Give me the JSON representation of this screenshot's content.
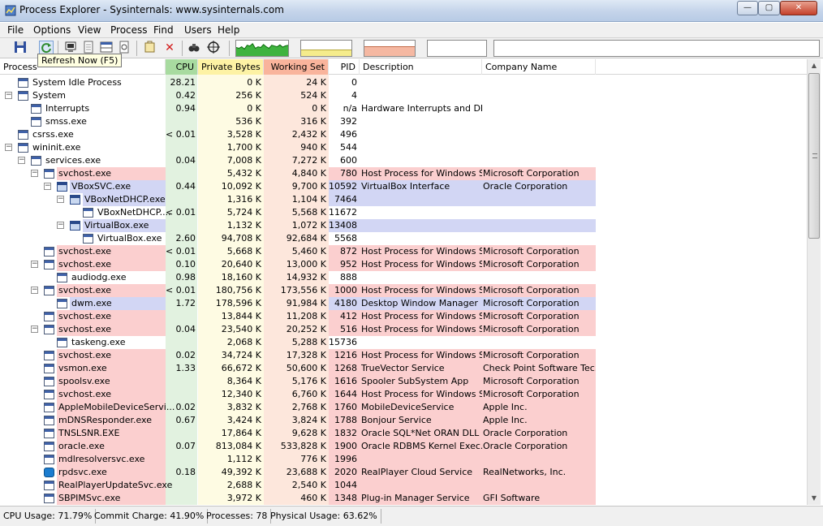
{
  "window": {
    "title": "Process Explorer - Sysinternals: www.sysinternals.com",
    "min_glyph": "—",
    "max_glyph": "▢",
    "close_glyph": "✕"
  },
  "menu": [
    "File",
    "Options",
    "View",
    "Process",
    "Find",
    "Users",
    "Help"
  ],
  "toolbar": {
    "tooltip": "Refresh Now (F5)",
    "icons": [
      "save-icon",
      "refresh-icon",
      "system-info-icon",
      "properties-icon",
      "lower-pane-icon",
      "dll-view-icon",
      "kill-process-icon",
      "find-icon",
      "target-window-icon"
    ]
  },
  "columns": {
    "process": "Process",
    "cpu": "CPU",
    "private_bytes": "Private Bytes",
    "working_set": "Working Set",
    "pid": "PID",
    "description": "Description",
    "company": "Company Name"
  },
  "colors": {
    "cpu_col": "#e2f2e0",
    "cpu_header": "#a8dba0",
    "private_col": "#fefbe3",
    "private_header": "#fdf2a4",
    "working_col": "#fde7dc",
    "working_header": "#f9b49c",
    "service": "#fbcfcf",
    "own": "#d2d6f4"
  },
  "processes": [
    {
      "name": "System Idle Process",
      "level": 0,
      "toggle": "",
      "cpu": "28.21",
      "private": "0 K",
      "working": "24 K",
      "pid": "0",
      "desc": "",
      "company": "",
      "hl": ""
    },
    {
      "name": "System",
      "level": 0,
      "toggle": "−",
      "cpu": "0.42",
      "private": "256 K",
      "working": "524 K",
      "pid": "4",
      "desc": "",
      "company": "",
      "hl": ""
    },
    {
      "name": "Interrupts",
      "level": 1,
      "toggle": "",
      "cpu": "0.94",
      "private": "0 K",
      "working": "0 K",
      "pid": "n/a",
      "desc": "Hardware Interrupts and DPCs",
      "company": "",
      "hl": ""
    },
    {
      "name": "smss.exe",
      "level": 1,
      "toggle": "",
      "cpu": "",
      "private": "536 K",
      "working": "316 K",
      "pid": "392",
      "desc": "",
      "company": "",
      "hl": ""
    },
    {
      "name": "csrss.exe",
      "level": 0,
      "toggle": "",
      "cpu": "< 0.01",
      "private": "3,528 K",
      "working": "2,432 K",
      "pid": "496",
      "desc": "",
      "company": "",
      "hl": ""
    },
    {
      "name": "wininit.exe",
      "level": 0,
      "toggle": "−",
      "cpu": "",
      "private": "1,700 K",
      "working": "940 K",
      "pid": "544",
      "desc": "",
      "company": "",
      "hl": ""
    },
    {
      "name": "services.exe",
      "level": 1,
      "toggle": "−",
      "cpu": "0.04",
      "private": "7,008 K",
      "working": "7,272 K",
      "pid": "600",
      "desc": "",
      "company": "",
      "hl": ""
    },
    {
      "name": "svchost.exe",
      "level": 2,
      "toggle": "−",
      "cpu": "",
      "private": "5,432 K",
      "working": "4,840 K",
      "pid": "780",
      "desc": "Host Process for Windows S...",
      "company": "Microsoft Corporation",
      "hl": "service"
    },
    {
      "name": "VBoxSVC.exe",
      "level": 3,
      "toggle": "−",
      "cpu": "0.44",
      "private": "10,092 K",
      "working": "9,700 K",
      "pid": "10592",
      "desc": "VirtualBox Interface",
      "company": "Oracle Corporation",
      "hl": "own",
      "icon": "vbox"
    },
    {
      "name": "VBoxNetDHCP.exe",
      "level": 4,
      "toggle": "−",
      "cpu": "",
      "private": "1,316 K",
      "working": "1,104 K",
      "pid": "7464",
      "desc": "",
      "company": "",
      "hl": "own",
      "icon": "vbox"
    },
    {
      "name": "VBoxNetDHCP....",
      "level": 5,
      "toggle": "",
      "cpu": "< 0.01",
      "private": "5,724 K",
      "working": "5,568 K",
      "pid": "11672",
      "desc": "",
      "company": "",
      "hl": ""
    },
    {
      "name": "VirtualBox.exe",
      "level": 4,
      "toggle": "−",
      "cpu": "",
      "private": "1,132 K",
      "working": "1,072 K",
      "pid": "13408",
      "desc": "",
      "company": "",
      "hl": "own",
      "icon": "vbox"
    },
    {
      "name": "VirtualBox.exe",
      "level": 5,
      "toggle": "",
      "cpu": "2.60",
      "private": "94,708 K",
      "working": "92,684 K",
      "pid": "5568",
      "desc": "",
      "company": "",
      "hl": ""
    },
    {
      "name": "svchost.exe",
      "level": 2,
      "toggle": "",
      "cpu": "< 0.01",
      "private": "5,668 K",
      "working": "5,460 K",
      "pid": "872",
      "desc": "Host Process for Windows S...",
      "company": "Microsoft Corporation",
      "hl": "service"
    },
    {
      "name": "svchost.exe",
      "level": 2,
      "toggle": "−",
      "cpu": "0.10",
      "private": "20,640 K",
      "working": "13,000 K",
      "pid": "952",
      "desc": "Host Process for Windows S...",
      "company": "Microsoft Corporation",
      "hl": "service"
    },
    {
      "name": "audiodg.exe",
      "level": 3,
      "toggle": "",
      "cpu": "0.98",
      "private": "18,160 K",
      "working": "14,932 K",
      "pid": "888",
      "desc": "",
      "company": "",
      "hl": ""
    },
    {
      "name": "svchost.exe",
      "level": 2,
      "toggle": "−",
      "cpu": "< 0.01",
      "private": "180,756 K",
      "working": "173,556 K",
      "pid": "1000",
      "desc": "Host Process for Windows S...",
      "company": "Microsoft Corporation",
      "hl": "service"
    },
    {
      "name": "dwm.exe",
      "level": 3,
      "toggle": "",
      "cpu": "1.72",
      "private": "178,596 K",
      "working": "91,984 K",
      "pid": "4180",
      "desc": "Desktop Window Manager",
      "company": "Microsoft Corporation",
      "hl": "own"
    },
    {
      "name": "svchost.exe",
      "level": 2,
      "toggle": "",
      "cpu": "",
      "private": "13,844 K",
      "working": "11,208 K",
      "pid": "412",
      "desc": "Host Process for Windows S...",
      "company": "Microsoft Corporation",
      "hl": "service"
    },
    {
      "name": "svchost.exe",
      "level": 2,
      "toggle": "−",
      "cpu": "0.04",
      "private": "23,540 K",
      "working": "20,252 K",
      "pid": "516",
      "desc": "Host Process for Windows S...",
      "company": "Microsoft Corporation",
      "hl": "service"
    },
    {
      "name": "taskeng.exe",
      "level": 3,
      "toggle": "",
      "cpu": "",
      "private": "2,068 K",
      "working": "5,288 K",
      "pid": "15736",
      "desc": "",
      "company": "",
      "hl": ""
    },
    {
      "name": "svchost.exe",
      "level": 2,
      "toggle": "",
      "cpu": "0.02",
      "private": "34,724 K",
      "working": "17,328 K",
      "pid": "1216",
      "desc": "Host Process for Windows S...",
      "company": "Microsoft Corporation",
      "hl": "service"
    },
    {
      "name": "vsmon.exe",
      "level": 2,
      "toggle": "",
      "cpu": "1.33",
      "private": "66,672 K",
      "working": "50,600 K",
      "pid": "1268",
      "desc": "TrueVector Service",
      "company": "Check Point Software Tec...",
      "hl": "service"
    },
    {
      "name": "spoolsv.exe",
      "level": 2,
      "toggle": "",
      "cpu": "",
      "private": "8,364 K",
      "working": "5,176 K",
      "pid": "1616",
      "desc": "Spooler SubSystem App",
      "company": "Microsoft Corporation",
      "hl": "service"
    },
    {
      "name": "svchost.exe",
      "level": 2,
      "toggle": "",
      "cpu": "",
      "private": "12,340 K",
      "working": "6,760 K",
      "pid": "1644",
      "desc": "Host Process for Windows S...",
      "company": "Microsoft Corporation",
      "hl": "service"
    },
    {
      "name": "AppleMobileDeviceServi...",
      "level": 2,
      "toggle": "",
      "cpu": "0.02",
      "private": "3,832 K",
      "working": "2,768 K",
      "pid": "1760",
      "desc": "MobileDeviceService",
      "company": "Apple Inc.",
      "hl": "service"
    },
    {
      "name": "mDNSResponder.exe",
      "level": 2,
      "toggle": "",
      "cpu": "0.67",
      "private": "3,424 K",
      "working": "3,824 K",
      "pid": "1788",
      "desc": "Bonjour Service",
      "company": "Apple Inc.",
      "hl": "service"
    },
    {
      "name": "TNSLSNR.EXE",
      "level": 2,
      "toggle": "",
      "cpu": "",
      "private": "17,864 K",
      "working": "9,628 K",
      "pid": "1832",
      "desc": "Oracle SQL*Net ORAN DLL",
      "company": "Oracle Corporation",
      "hl": "service"
    },
    {
      "name": "oracle.exe",
      "level": 2,
      "toggle": "",
      "cpu": "0.07",
      "private": "813,084 K",
      "working": "533,828 K",
      "pid": "1900",
      "desc": "Oracle RDBMS Kernel Exec...",
      "company": "Oracle Corporation",
      "hl": "service"
    },
    {
      "name": "mdlresolversvc.exe",
      "level": 2,
      "toggle": "",
      "cpu": "",
      "private": "1,112 K",
      "working": "776 K",
      "pid": "1996",
      "desc": "",
      "company": "",
      "hl": "service"
    },
    {
      "name": "rpdsvc.exe",
      "level": 2,
      "toggle": "",
      "cpu": "0.18",
      "private": "49,392 K",
      "working": "23,688 K",
      "pid": "2020",
      "desc": "RealPlayer Cloud Service",
      "company": "RealNetworks, Inc.",
      "hl": "service",
      "icon": "rp"
    },
    {
      "name": "RealPlayerUpdateSvc.exe",
      "level": 2,
      "toggle": "",
      "cpu": "",
      "private": "2,688 K",
      "working": "2,540 K",
      "pid": "1044",
      "desc": "",
      "company": "",
      "hl": "service"
    },
    {
      "name": "SBPIMSvc.exe",
      "level": 2,
      "toggle": "",
      "cpu": "",
      "private": "3,972 K",
      "working": "460 K",
      "pid": "1348",
      "desc": "Plug-in Manager Service",
      "company": "GFI Software",
      "hl": "service"
    }
  ],
  "status": {
    "cpu": "CPU Usage: 71.79%",
    "commit": "Commit Charge: 41.90%",
    "processes": "Processes: 78",
    "physical": "Physical Usage: 63.62%"
  },
  "graphs": {
    "cpu_history": [
      0.55,
      0.5,
      0.6,
      0.45,
      0.7,
      0.65,
      0.8,
      0.5,
      0.6,
      0.55,
      0.75,
      0.6,
      0.5,
      0.7,
      0.65,
      0.6,
      0.72,
      0.58,
      0.66,
      0.7
    ],
    "commit_level": 0.42,
    "physical_level": 0.64
  }
}
